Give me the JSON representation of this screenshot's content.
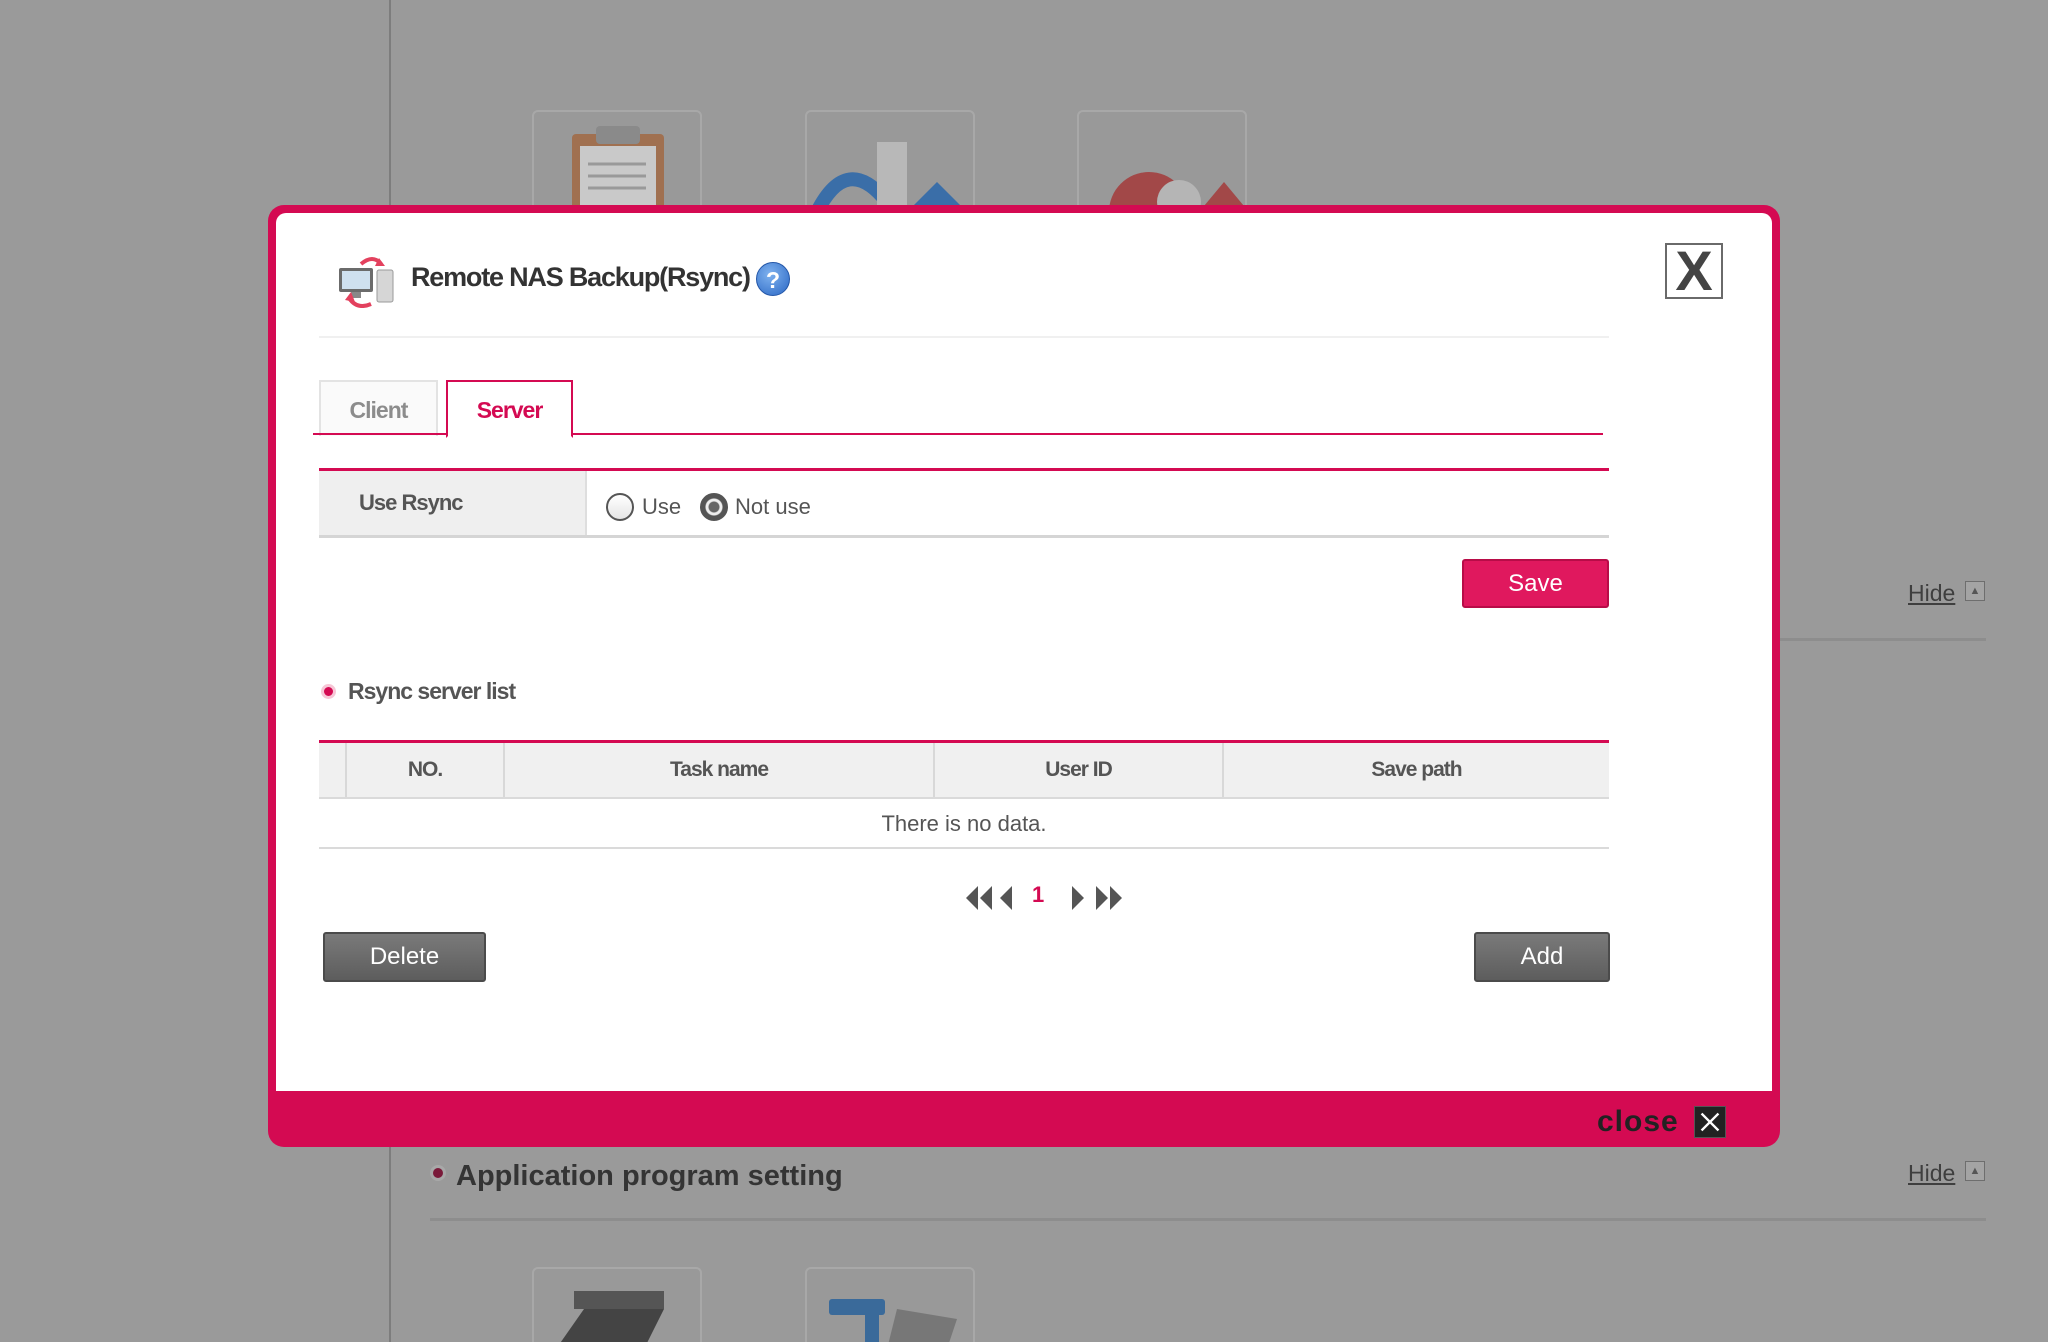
{
  "dialog": {
    "title": "Remote NAS Backup(Rsync)",
    "help_glyph": "?",
    "close_x": "X",
    "close_label": "close"
  },
  "tabs": [
    {
      "label": "Client",
      "active": false
    },
    {
      "label": "Server",
      "active": true
    }
  ],
  "options": {
    "use_rsync_label": "Use Rsync",
    "radio_use": "Use",
    "radio_not_use": "Not use",
    "selected": "Not use"
  },
  "buttons": {
    "save": "Save",
    "delete": "Delete",
    "add": "Add"
  },
  "server_list": {
    "title": "Rsync server list",
    "columns": [
      "NO.",
      "Task name",
      "User ID",
      "Save path"
    ],
    "empty_message": "There is no data.",
    "current_page": "1"
  },
  "background": {
    "hide_label": "Hide",
    "section_title": "Application program setting"
  },
  "colors": {
    "accent": "#d40a52",
    "dark_button": "#666666"
  }
}
